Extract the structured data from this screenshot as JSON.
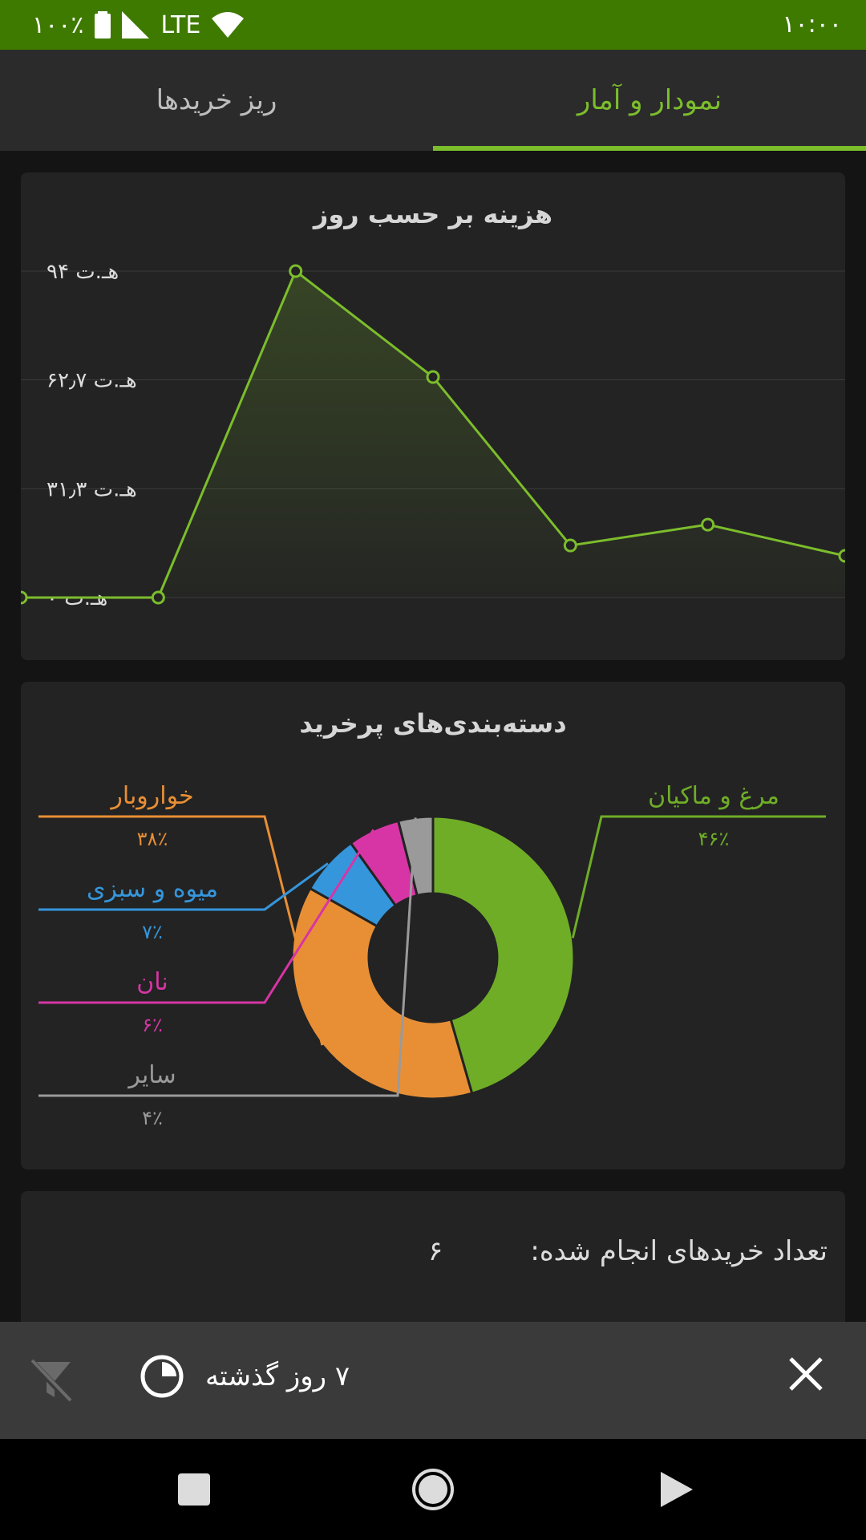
{
  "status_bar": {
    "time": "۱۰:۰۰",
    "battery": "۱۰۰٪",
    "network": "LTE",
    "icons": [
      "wifi-icon",
      "signal-icon",
      "battery-icon"
    ]
  },
  "tabs": [
    {
      "label": "نمودار و آمار",
      "active": true
    },
    {
      "label": "ریز خریدها",
      "active": false
    }
  ],
  "colors": {
    "accent": "#7cbd2c",
    "status_bar": "#3f7a00",
    "card": "#232323",
    "orange": "#e88f35",
    "blue": "#3596dc",
    "pink": "#d735a5",
    "gray": "#9a9a9a",
    "green": "#6fad27"
  },
  "line_chart_card": {
    "title": "هزینه بر حسب روز"
  },
  "pie_chart_card": {
    "title": "دسته‌بندی‌های پرخرید"
  },
  "chart_data": [
    {
      "type": "line",
      "title": "هزینه بر حسب روز",
      "y_ticks": [
        {
          "label": "۹۴ هـ.ت",
          "value": 94
        },
        {
          "label": "۶۲٫۷ هـ.ت",
          "value": 62.7
        },
        {
          "label": "۳۱٫۳ هـ.ت",
          "value": 31.3
        },
        {
          "label": "۰ هـ.ت",
          "value": 0
        }
      ],
      "ylim": [
        0,
        94
      ],
      "x": [
        0,
        1,
        2,
        3,
        4,
        5,
        6
      ],
      "values": [
        0,
        0,
        94,
        63.5,
        15,
        21,
        12
      ],
      "area_fill": true,
      "grid": true
    },
    {
      "type": "pie",
      "title": "دسته‌بندی‌های پرخرید",
      "donut": true,
      "slices": [
        {
          "label": "مرغ و ماکیان",
          "percent_label": "۴۶٪",
          "value": 46,
          "color": "#6fad27"
        },
        {
          "label": "خواروبار",
          "percent_label": "۳۸٪",
          "value": 38,
          "color": "#e88f35"
        },
        {
          "label": "میوه و سبزی",
          "percent_label": "۷٪",
          "value": 7,
          "color": "#3596dc"
        },
        {
          "label": "نان",
          "percent_label": "۶٪",
          "value": 6,
          "color": "#d735a5"
        },
        {
          "label": "سایر",
          "percent_label": "۴٪",
          "value": 4,
          "color": "#9a9a9a"
        }
      ]
    }
  ],
  "stats_card": {
    "count_label": "تعداد خریدهای انجام شده:",
    "count_value": "۶"
  },
  "bottom_panel": {
    "period_label": "۷ روز گذشته",
    "icons": [
      "clock-icon",
      "close-icon",
      "filter-off-icon"
    ]
  },
  "nav_bar": {
    "icons": [
      "recents-icon",
      "home-icon",
      "back-icon"
    ]
  }
}
